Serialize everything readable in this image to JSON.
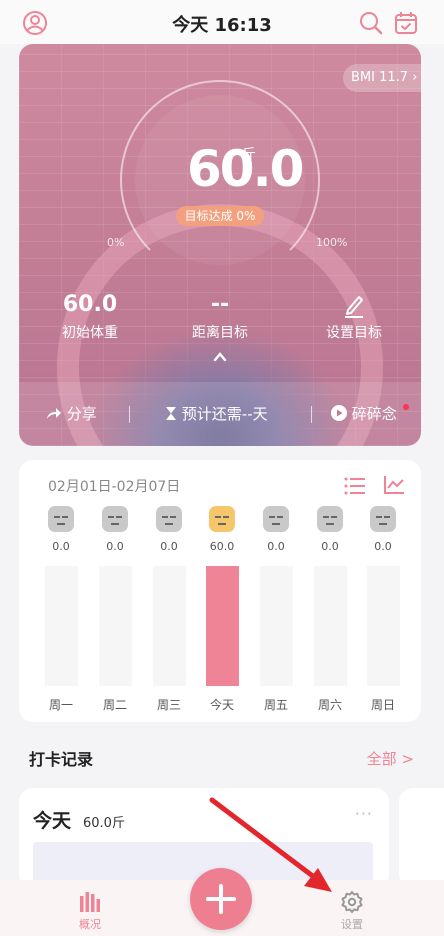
{
  "header": {
    "title": "今天 16:13"
  },
  "hero": {
    "bmi_label": "BMI 11.7",
    "weight": "60.0",
    "weight_unit": "斤",
    "goal_progress": "目标达成 0%",
    "pct_left": "0%",
    "pct_right": "100%",
    "stats": [
      {
        "value": "60.0",
        "label": "初始体重"
      },
      {
        "value": "--",
        "label": "距离目标"
      },
      {
        "value": "",
        "label": "设置目标"
      }
    ],
    "actions": {
      "share": "分享",
      "estimate": "预计还需--天",
      "chatter": "碎碎念"
    }
  },
  "week": {
    "range": "02月01日-02月07日",
    "days": [
      {
        "label": "周一",
        "value": "0.0",
        "fill": 0
      },
      {
        "label": "周二",
        "value": "0.0",
        "fill": 0
      },
      {
        "label": "周三",
        "value": "0.0",
        "fill": 0
      },
      {
        "label": "今天",
        "value": "60.0",
        "fill": 1
      },
      {
        "label": "周五",
        "value": "0.0",
        "fill": 0
      },
      {
        "label": "周六",
        "value": "0.0",
        "fill": 0
      },
      {
        "label": "周日",
        "value": "0.0",
        "fill": 0
      }
    ]
  },
  "records": {
    "title": "打卡记录",
    "all": "全部 >",
    "card": {
      "day": "今天",
      "weight": "60.0斤",
      "more": "···"
    }
  },
  "nav": {
    "overview": "概况",
    "settings": "设置"
  },
  "colors": {
    "accent": "#ee8495",
    "goal_pill": "#f2a07f",
    "today_face": "#f6c66a"
  }
}
